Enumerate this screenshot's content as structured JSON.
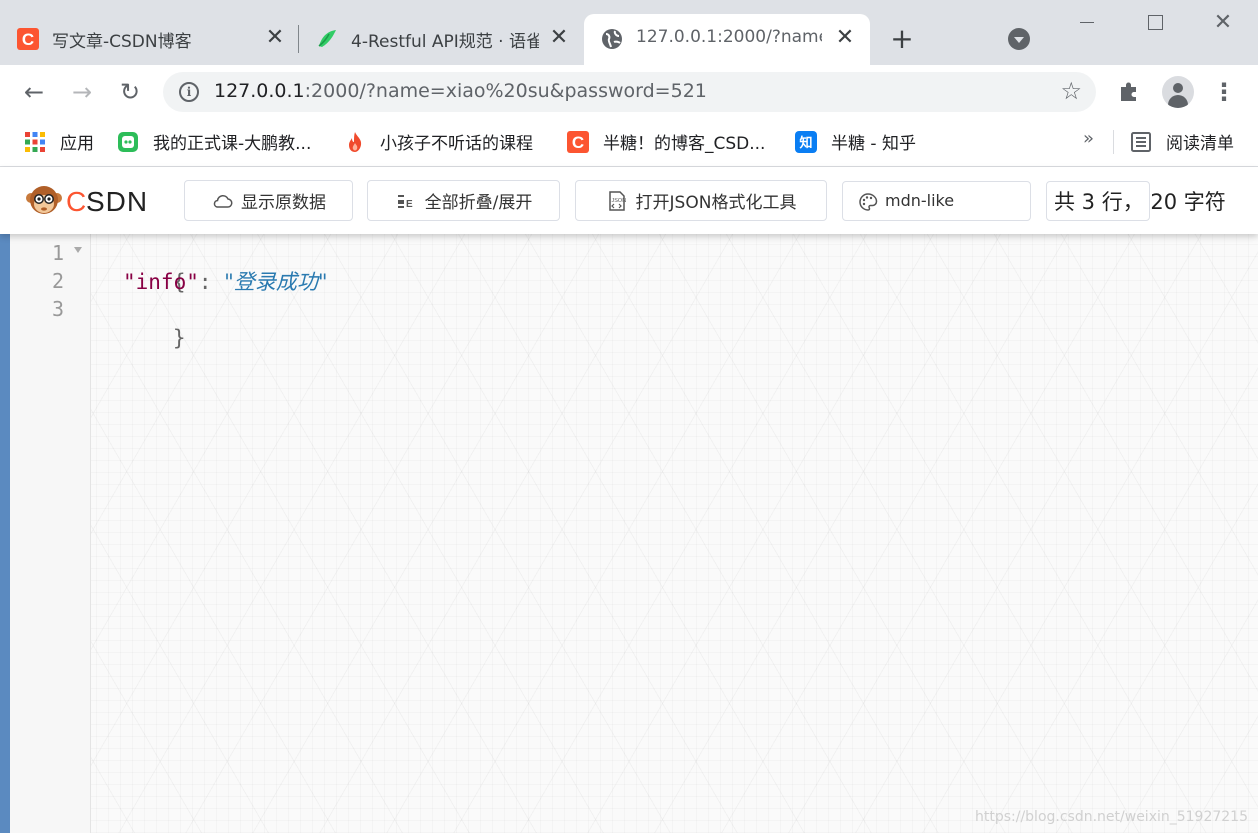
{
  "browser": {
    "tabs": [
      {
        "title": "写文章-CSDN博客",
        "close": "✕"
      },
      {
        "title": "4-Restful API规范 · 语雀",
        "close": "✕"
      },
      {
        "title": "127.0.0.1:2000/?name=xiao%20su&password=521",
        "close": "✕"
      }
    ],
    "new_tab": "+",
    "window_close": "✕",
    "address": {
      "host": "127.0.0.1",
      "rest": ":2000/?name=xiao%20su&password=521"
    },
    "back": "←",
    "forward": "→",
    "reload": "↻",
    "star": "☆",
    "menu": "⋮"
  },
  "bookmarks": {
    "items": [
      {
        "label": "应用",
        "icon": "apps-grid-icon"
      },
      {
        "label": "我的正式课-大鹏教...",
        "icon": "green-course-icon"
      },
      {
        "label": "小孩子不听话的课程",
        "icon": "flame-icon"
      },
      {
        "label": "半糖！的博客_CSD...",
        "icon": "csdn-icon"
      },
      {
        "label": "半糖 - 知乎",
        "icon": "zhihu-icon"
      }
    ],
    "more": "»",
    "reading_list": "阅读清单"
  },
  "viewer": {
    "logo_text": "CSDN",
    "show_raw": "显示原数据",
    "collapse_all": "全部折叠/展开",
    "open_formatter": "打开JSON格式化工具",
    "theme": "mdn-like",
    "line_count_text": "共 3 行， 20 字符"
  },
  "editor": {
    "line_numbers": [
      "1",
      "2",
      "3"
    ],
    "open_brace": "{",
    "key": "\"info\"",
    "colon": ": ",
    "value": "\"登录成功\"",
    "close_brace": "}"
  },
  "watermark": "https://blog.csdn.net/weixin_51927215",
  "colors": {
    "accent_bar": "#5b8ac0",
    "json_key": "#880044",
    "json_string": "#2a7ab0",
    "csdn_red": "#fc5531"
  }
}
